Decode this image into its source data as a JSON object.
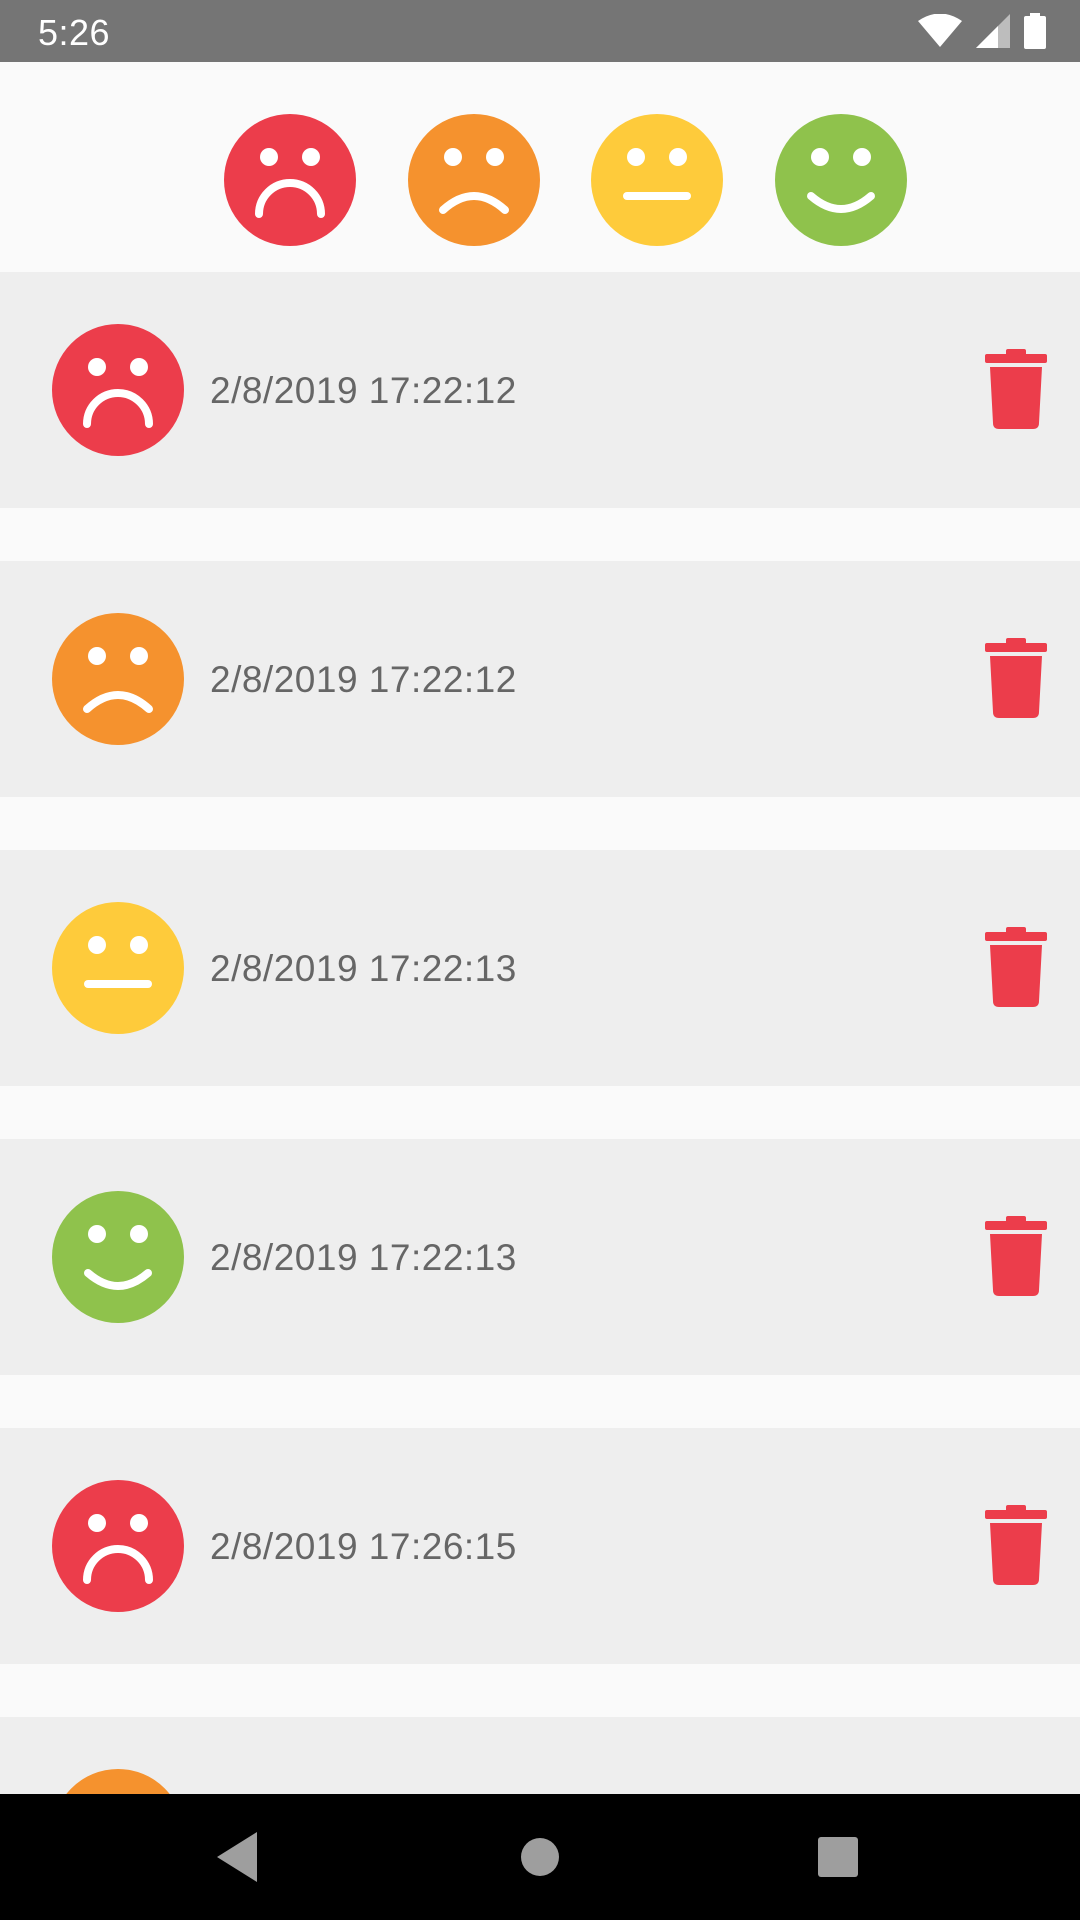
{
  "status_bar": {
    "time": "5:26",
    "icons": [
      "wifi-icon",
      "cell-signal-icon",
      "battery-icon"
    ],
    "background": "#757575"
  },
  "mood_picker": {
    "options": [
      {
        "mood": "very-sad",
        "icon": "very-sad-face-icon",
        "color": "#ec3d4b"
      },
      {
        "mood": "sad",
        "icon": "sad-face-icon",
        "color": "#f5922e"
      },
      {
        "mood": "neutral",
        "icon": "neutral-face-icon",
        "color": "#fecb3b"
      },
      {
        "mood": "happy",
        "icon": "happy-face-icon",
        "color": "#8fc24c"
      }
    ]
  },
  "entries": [
    {
      "mood": "very-sad",
      "icon": "very-sad-face-icon",
      "color": "#ec3d4b",
      "timestamp": "2/8/2019 17:22:12"
    },
    {
      "mood": "sad",
      "icon": "sad-face-icon",
      "color": "#f5922e",
      "timestamp": "2/8/2019 17:22:12"
    },
    {
      "mood": "neutral",
      "icon": "neutral-face-icon",
      "color": "#fecb3b",
      "timestamp": "2/8/2019 17:22:13"
    },
    {
      "mood": "happy",
      "icon": "happy-face-icon",
      "color": "#8fc24c",
      "timestamp": "2/8/2019 17:22:13"
    },
    {
      "mood": "very-sad",
      "icon": "very-sad-face-icon",
      "color": "#ec3d4b",
      "timestamp": "2/8/2019 17:26:15"
    },
    {
      "mood": "sad",
      "icon": "sad-face-icon",
      "color": "#f5922e",
      "timestamp": ""
    }
  ],
  "delete_icon": {
    "name": "trash-icon",
    "color": "#ec3d4b"
  },
  "nav_bar": {
    "buttons": [
      "back-icon",
      "home-icon",
      "recents-icon"
    ]
  }
}
